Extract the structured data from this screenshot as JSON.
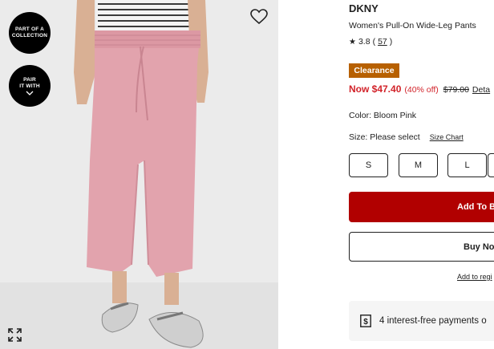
{
  "image_panel": {
    "collection_badge": {
      "line1": "PART OF A",
      "line2": "COLLECTION"
    },
    "pair_badge": {
      "line1": "PAIR",
      "line2": "IT WITH"
    },
    "icons": {
      "wishlist": "heart-outline-icon",
      "expand": "expand-arrows-icon",
      "pair_toggle": "chevron-down-icon"
    }
  },
  "product": {
    "brand": "DKNY",
    "name": "Women's Pull-On Wide-Leg Pants",
    "rating": {
      "value": "3.8",
      "count": "57"
    },
    "badge": "Clearance",
    "price": {
      "now": "Now $47.40",
      "discount": "(40% off)",
      "was": "$79.00",
      "details_link": "Deta"
    },
    "color": "Color: Bloom Pink",
    "size_label": "Size: Please select",
    "size_chart_link": "Size Chart",
    "sizes": [
      "S",
      "M",
      "L"
    ],
    "add_to_bag": "Add To B",
    "buy_now": "Buy Now",
    "registry_link": "Add to regi",
    "payment_message": "4 interest-free payments o"
  },
  "colors": {
    "clearance": "#b76000",
    "sale_red": "#d2232a",
    "add_button": "#b10000",
    "pants": "#e2a3ad"
  }
}
